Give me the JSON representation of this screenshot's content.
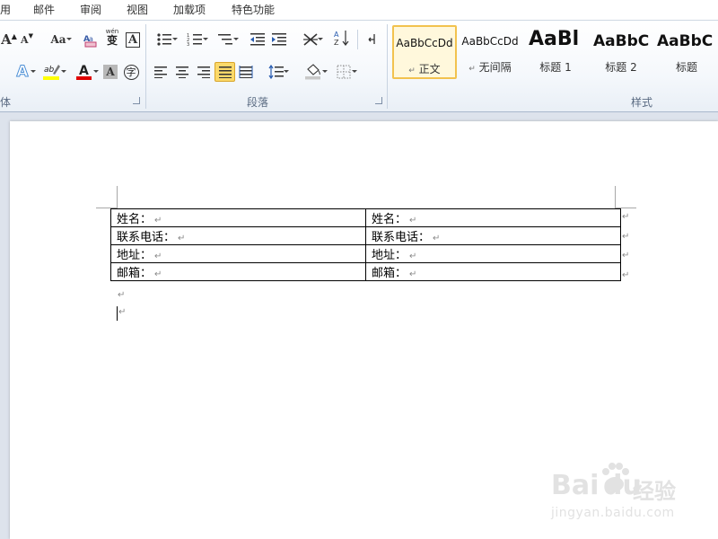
{
  "menu": [
    "用",
    "邮件",
    "审阅",
    "视图",
    "加载项",
    "特色功能"
  ],
  "ribbon": {
    "font_group_label": "体",
    "paragraph_group_label": "段落",
    "styles_group_label": "样式",
    "grow_font_glyph": "A",
    "shrink_font_glyph": "A",
    "change_case_glyph": "Aa",
    "phonetic_glyph": "wén",
    "phonetic_char": "变",
    "char_border_glyph": "A",
    "font_color_glyph": "A",
    "highlight_glyph": "ab",
    "char_shading_glyph": "A",
    "enclose_char_glyph": "字",
    "text_effect_glyph": "A",
    "sort_glyph": "A",
    "sort_glyph2": "Z"
  },
  "styles": [
    {
      "sample": "AaBbCcDd",
      "name": "正文",
      "marker": "↵",
      "selected": true
    },
    {
      "sample": "AaBbCcDd",
      "name": "无间隔",
      "marker": "↵",
      "selected": false
    },
    {
      "sample": "AaBl",
      "name": "标题 1",
      "marker": "",
      "selected": false
    },
    {
      "sample": "AaBbC",
      "name": "标题 2",
      "marker": "",
      "selected": false
    },
    {
      "sample": "AaBbC",
      "name": "标题",
      "marker": "",
      "selected": false
    }
  ],
  "document": {
    "table": [
      [
        "姓名：",
        "姓名："
      ],
      [
        "联系电话：",
        "联系电话："
      ],
      [
        "地址：",
        "地址："
      ],
      [
        "邮箱：",
        "邮箱："
      ]
    ],
    "para_mark": "↵"
  },
  "watermark": {
    "brand": "Bai",
    "brand2": "du",
    "brand_cn": "经验",
    "url": "jingyan.baidu.com"
  },
  "colors": {
    "font_color_bar": "#e00000",
    "highlight_bar": "#ffff00",
    "selected_style_border": "#f2c24e",
    "active_button": "#fbd96a"
  }
}
